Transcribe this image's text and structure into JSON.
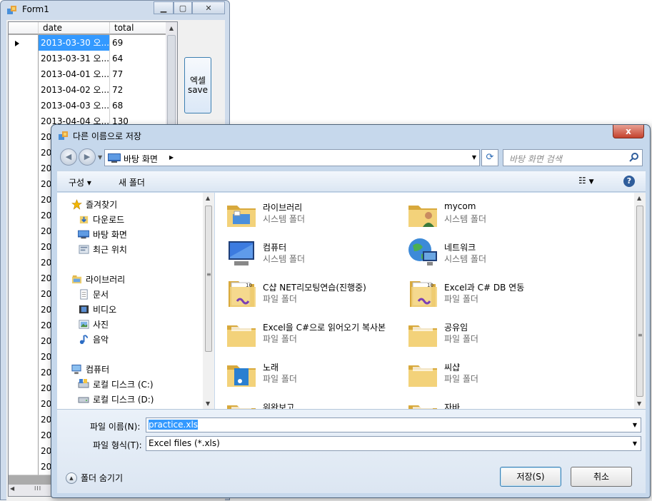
{
  "form1": {
    "title": "Form1",
    "grid": {
      "headers": [
        "date",
        "total"
      ],
      "rows": [
        {
          "date": "2013-03-30 오...",
          "total": "69"
        },
        {
          "date": "2013-03-31 오...",
          "total": "64"
        },
        {
          "date": "2013-04-01 오...",
          "total": "77"
        },
        {
          "date": "2013-04-02 오...",
          "total": "72"
        },
        {
          "date": "2013-04-03 오...",
          "total": "68"
        },
        {
          "date": "2013-04-04 오...",
          "total": "130"
        }
      ],
      "truncated_prefix": "201",
      "hscroll_grip": "III"
    },
    "excel_button": {
      "line1": "엑셀",
      "line2": "save"
    }
  },
  "dialog": {
    "title": "다른 이름으로 저장",
    "close_label": "x",
    "address": "바탕 화면",
    "search_placeholder": "바탕 화면 검색",
    "toolbar": {
      "organize": "구성 ▾",
      "new_folder": "새 폴더",
      "help": "?"
    },
    "nav": [
      {
        "label": "즐겨찾기",
        "icon": "star-icon",
        "indent": 0
      },
      {
        "label": "다운로드",
        "icon": "downloads-icon",
        "indent": 1
      },
      {
        "label": "바탕 화면",
        "icon": "desktop-icon",
        "indent": 1
      },
      {
        "label": "최근 위치",
        "icon": "recent-places-icon",
        "indent": 1
      },
      {
        "label": "라이브러리",
        "icon": "libraries-icon",
        "indent": 0
      },
      {
        "label": "문서",
        "icon": "documents-icon",
        "indent": 1
      },
      {
        "label": "비디오",
        "icon": "video-icon",
        "indent": 1
      },
      {
        "label": "사진",
        "icon": "pictures-icon",
        "indent": 1
      },
      {
        "label": "음악",
        "icon": "music-icon",
        "indent": 1
      },
      {
        "label": "컴퓨터",
        "icon": "computer-icon",
        "indent": 0
      },
      {
        "label": "로컬 디스크 (C:)",
        "icon": "drive-c-icon",
        "indent": 1
      },
      {
        "label": "로컬 디스크 (D:)",
        "icon": "drive-d-icon",
        "indent": 1
      }
    ],
    "files": [
      {
        "name": "라이브러리",
        "type": "시스템 폴더",
        "icon": "libraries-folder-icon"
      },
      {
        "name": "mycom",
        "type": "시스템 폴더",
        "icon": "user-folder-icon"
      },
      {
        "name": "컴퓨터",
        "type": "시스템 폴더",
        "icon": "computer-icon"
      },
      {
        "name": "네트워크",
        "type": "시스템 폴더",
        "icon": "network-icon"
      },
      {
        "name": "C샵 NET리모팅연습(진행중)",
        "type": "파일 폴더",
        "icon": "vs-folder-icon"
      },
      {
        "name": "Excel과 C# DB 연동",
        "type": "파일 폴더",
        "icon": "vs-folder-icon"
      },
      {
        "name": "Excel을 C#으로 읽어오기 복사본",
        "type": "파일 폴더",
        "icon": "folder-icon"
      },
      {
        "name": "공유임",
        "type": "파일 폴더",
        "icon": "folder-icon"
      },
      {
        "name": "노래",
        "type": "파일 폴더",
        "icon": "music-folder-icon"
      },
      {
        "name": "씨샵",
        "type": "파일 폴더",
        "icon": "folder-icon"
      },
      {
        "name": "워완보고",
        "type": "",
        "icon": "folder-icon"
      },
      {
        "name": "자바",
        "type": "",
        "icon": "folder-icon"
      }
    ],
    "filename_label": "파일 이름(N):",
    "filename_value": "practice.xls",
    "filetype_label": "파일 형식(T):",
    "filetype_value": "Excel files (*.xls)",
    "hide_folders": "폴더 숨기기",
    "save_button": "저장(S)",
    "cancel_button": "취소"
  },
  "colors": {
    "selection": "#3399ff",
    "dialog_frame": "#c6d8ec",
    "folder": "#e9c46a"
  }
}
